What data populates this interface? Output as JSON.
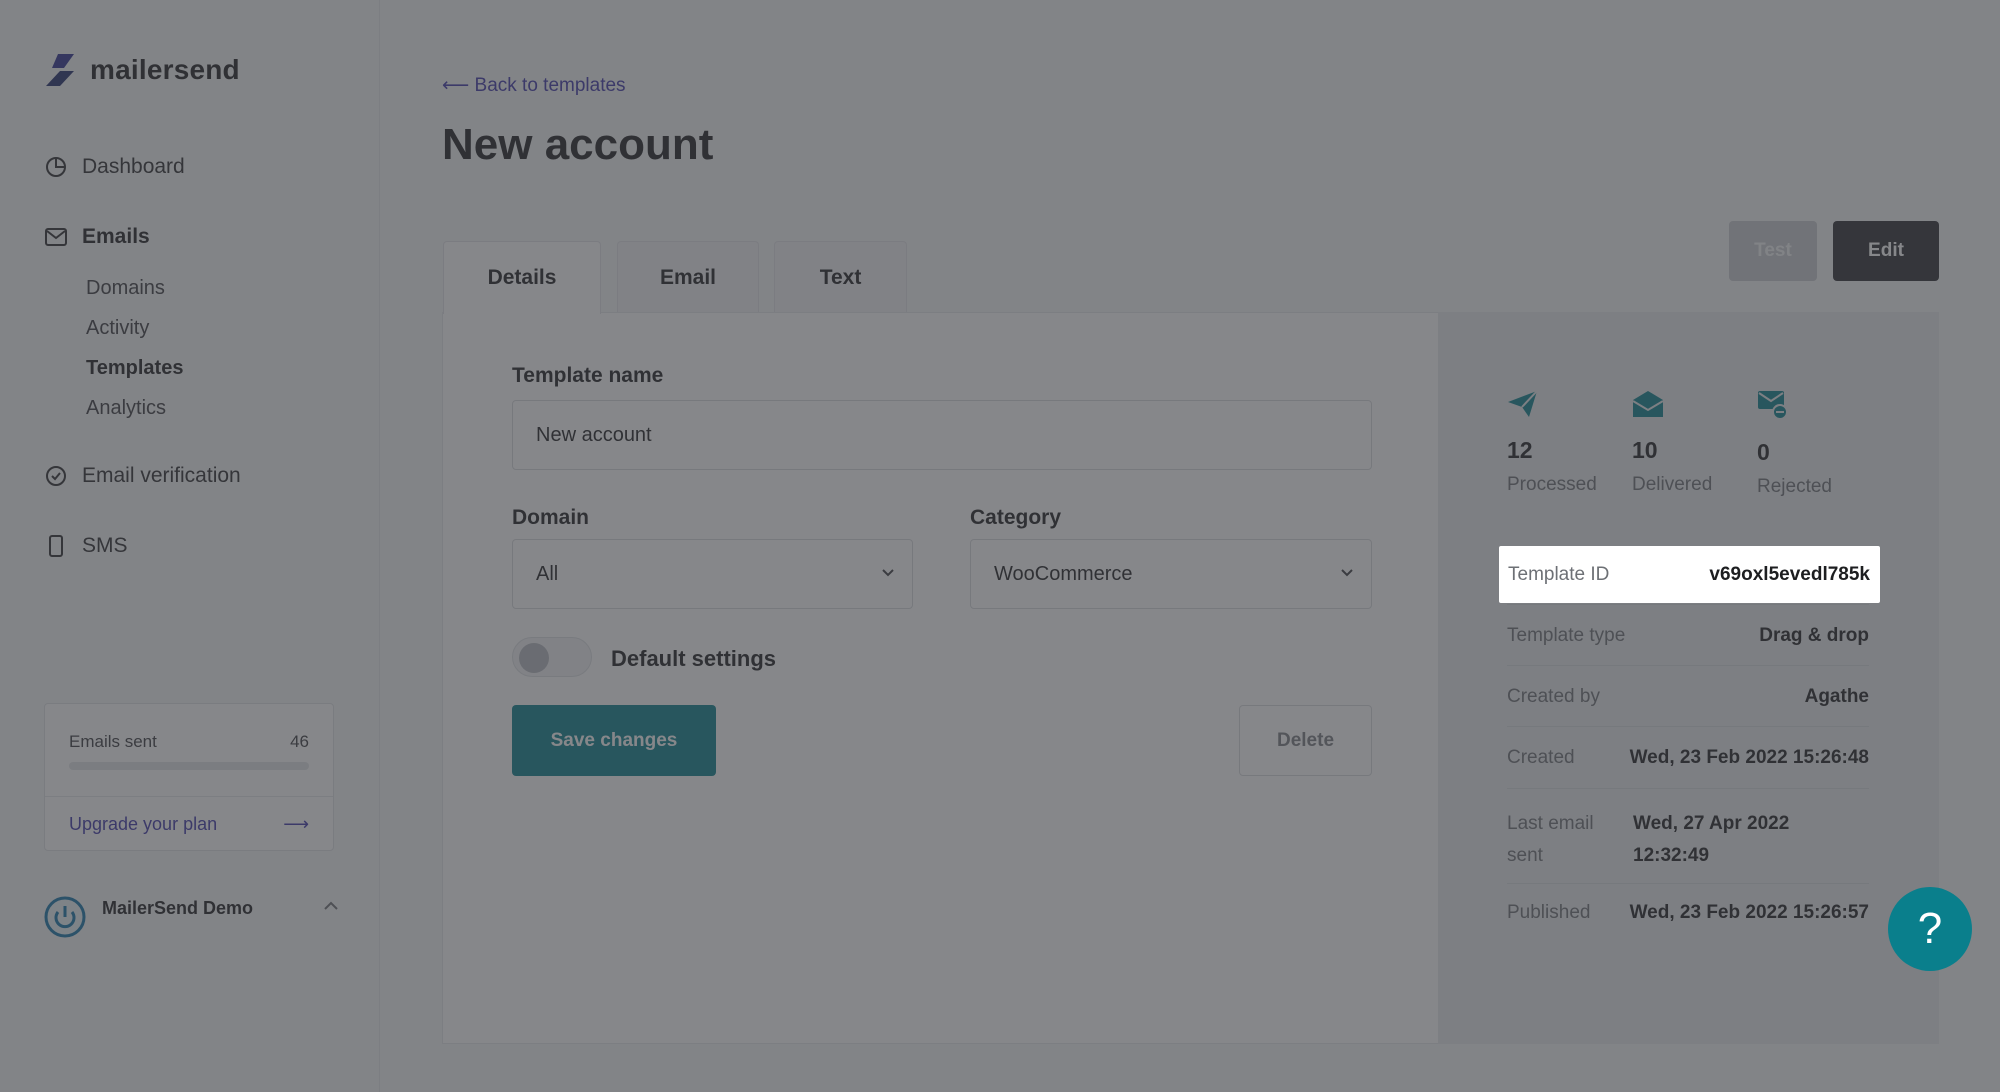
{
  "brand": {
    "name": "mailersend"
  },
  "sidebar": {
    "nav": [
      {
        "label": "Dashboard"
      },
      {
        "label": "Emails"
      },
      {
        "label": "Email verification"
      },
      {
        "label": "SMS"
      }
    ],
    "email_sub": [
      {
        "label": "Domains"
      },
      {
        "label": "Activity"
      },
      {
        "label": "Templates"
      },
      {
        "label": "Analytics"
      }
    ],
    "usage": {
      "label": "Emails sent",
      "count": "46",
      "fill_fraction": 0.0,
      "upgrade_label": "Upgrade your plan",
      "upgrade_arrow": "⟶"
    },
    "account": {
      "name": "MailerSend Demo"
    }
  },
  "header": {
    "back_link": "⟵ Back to templates",
    "title": "New account",
    "test_label": "Test",
    "edit_label": "Edit"
  },
  "tabs": [
    {
      "label": "Details"
    },
    {
      "label": "Email"
    },
    {
      "label": "Text"
    }
  ],
  "form": {
    "template_name_label": "Template name",
    "template_name_value": "New account",
    "domain_label": "Domain",
    "domain_value": "All",
    "category_label": "Category",
    "category_value": "WooCommerce",
    "default_settings_label": "Default settings",
    "save_label": "Save changes",
    "delete_label": "Delete"
  },
  "stats": [
    {
      "value": "12",
      "label": "Processed",
      "icon": "paper-plane-icon"
    },
    {
      "value": "10",
      "label": "Delivered",
      "icon": "open-envelope-icon"
    },
    {
      "value": "0",
      "label": "Rejected",
      "icon": "rejected-mail-icon"
    }
  ],
  "meta": {
    "template_id_label": "Template ID",
    "template_id_value": "v69oxl5evedl785k",
    "template_type_label": "Template type",
    "template_type_value": "Drag & drop",
    "created_by_label": "Created by",
    "created_by_value": "Agathe",
    "created_label": "Created",
    "created_value": "Wed, 23 Feb 2022 15:26:48",
    "last_email_label_1": "Last email",
    "last_email_label_2": "sent",
    "last_email_value_1": "Wed, 27 Apr 2022",
    "last_email_value_2": "12:32:49",
    "published_label": "Published",
    "published_value": "Wed, 23 Feb 2022 15:26:57"
  },
  "help": {
    "label": "?"
  },
  "colors": {
    "accent": "#0a7f8c",
    "link": "#3d36a8",
    "dark_button": "#2a2c30"
  }
}
